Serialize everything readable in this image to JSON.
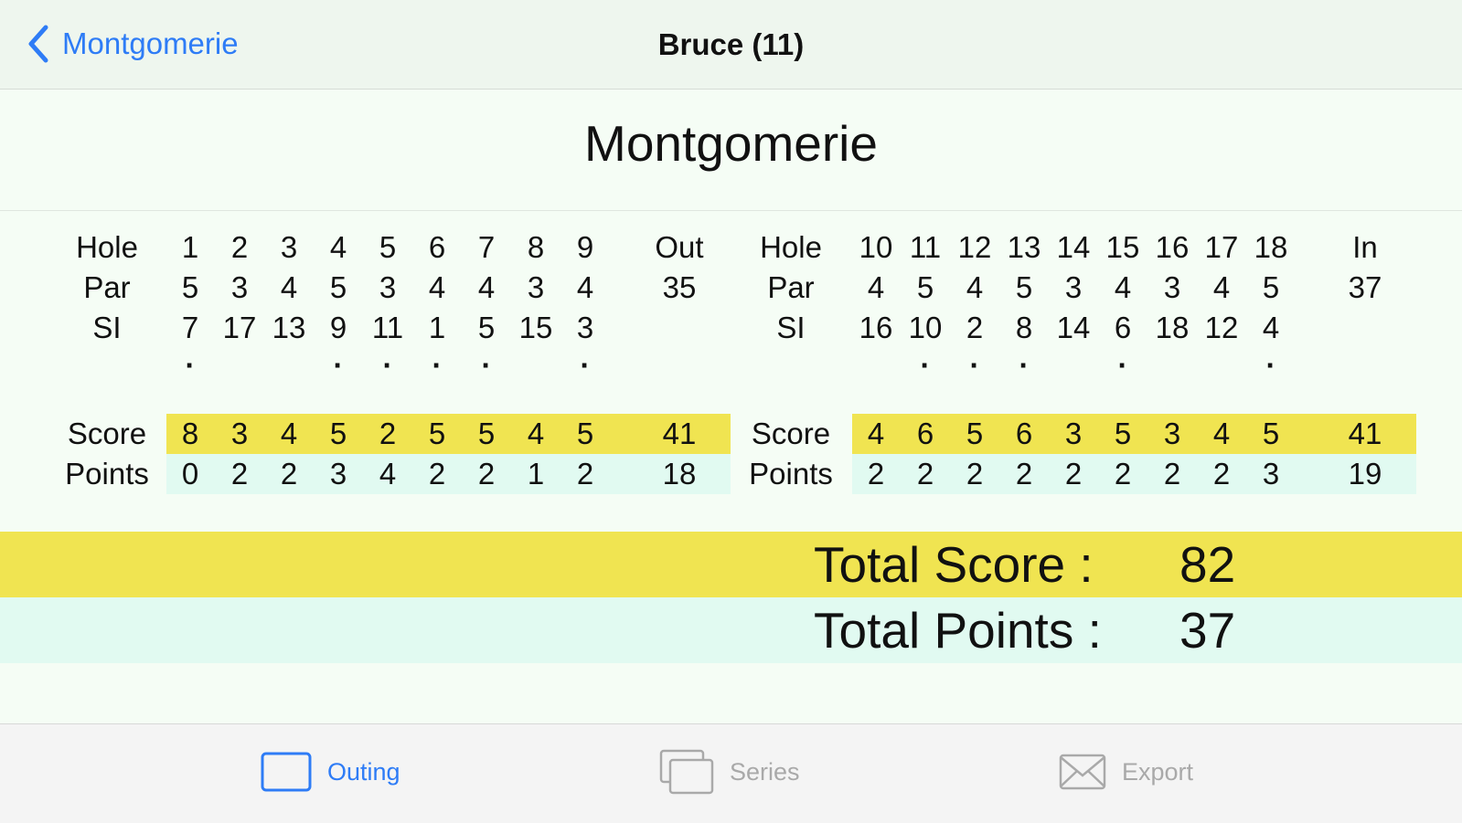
{
  "nav": {
    "back_label": "Montgomerie",
    "title": "Bruce  (11)"
  },
  "course": {
    "title": "Montgomerie"
  },
  "front": {
    "labels": {
      "hole": "Hole",
      "par": "Par",
      "si": "SI",
      "score": "Score",
      "points": "Points"
    },
    "holes": [
      "1",
      "2",
      "3",
      "4",
      "5",
      "6",
      "7",
      "8",
      "9"
    ],
    "total_label": "Out",
    "par": [
      "5",
      "3",
      "4",
      "5",
      "3",
      "4",
      "4",
      "3",
      "4"
    ],
    "par_total": "35",
    "si": [
      "7",
      "17",
      "13",
      "9",
      "11",
      "1",
      "5",
      "15",
      "3"
    ],
    "dots": [
      "·",
      "",
      "",
      "·",
      "·",
      "·",
      "·",
      "",
      "·"
    ],
    "score": [
      "8",
      "3",
      "4",
      "5",
      "2",
      "5",
      "5",
      "4",
      "5"
    ],
    "score_total": "41",
    "points": [
      "0",
      "2",
      "2",
      "3",
      "4",
      "2",
      "2",
      "1",
      "2"
    ],
    "points_total": "18"
  },
  "back": {
    "labels": {
      "hole": "Hole",
      "par": "Par",
      "si": "SI",
      "score": "Score",
      "points": "Points"
    },
    "holes": [
      "10",
      "11",
      "12",
      "13",
      "14",
      "15",
      "16",
      "17",
      "18"
    ],
    "total_label": "In",
    "par": [
      "4",
      "5",
      "4",
      "5",
      "3",
      "4",
      "3",
      "4",
      "5"
    ],
    "par_total": "37",
    "si": [
      "16",
      "10",
      "2",
      "8",
      "14",
      "6",
      "18",
      "12",
      "4"
    ],
    "dots": [
      "",
      "·",
      "·",
      "·",
      "",
      "·",
      "",
      "",
      "·"
    ],
    "score": [
      "4",
      "6",
      "5",
      "6",
      "3",
      "5",
      "3",
      "4",
      "5"
    ],
    "score_total": "41",
    "points": [
      "2",
      "2",
      "2",
      "2",
      "2",
      "2",
      "2",
      "2",
      "3"
    ],
    "points_total": "19"
  },
  "totals": {
    "score_label": "Total Score  :",
    "score_value": "82",
    "points_label": "Total Points :",
    "points_value": "37"
  },
  "tabs": [
    {
      "label": "Outing",
      "icon": "outing-icon",
      "active": true
    },
    {
      "label": "Series",
      "icon": "series-icon",
      "active": false
    },
    {
      "label": "Export",
      "icon": "envelope-icon",
      "active": false
    }
  ],
  "colors": {
    "accent": "#2e7cf6",
    "score_band": "#f0e451",
    "points_band": "#e1faf1",
    "inactive_tab": "#a9a9a9"
  }
}
